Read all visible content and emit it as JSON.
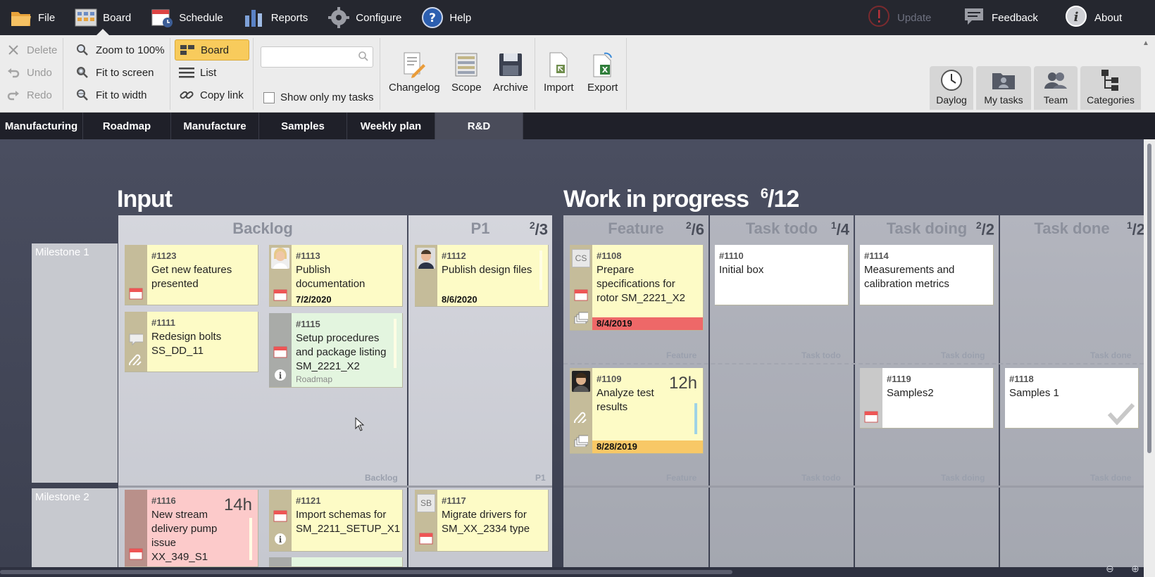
{
  "menu": {
    "file": "File",
    "board": "Board",
    "schedule": "Schedule",
    "reports": "Reports",
    "configure": "Configure",
    "help": "Help",
    "update": "Update",
    "feedback": "Feedback",
    "about": "About"
  },
  "ribbon": {
    "delete": "Delete",
    "undo": "Undo",
    "redo": "Redo",
    "zoom_100": "Zoom to 100%",
    "fit_screen": "Fit to screen",
    "fit_width": "Fit to width",
    "board_view": "Board",
    "list_view": "List",
    "copy_link": "Copy link",
    "search_value": "",
    "show_only_my_tasks": "Show only my tasks",
    "changelog": "Changelog",
    "scope": "Scope",
    "archive": "Archive",
    "import": "Import",
    "export": "Export",
    "daylog": "Daylog",
    "my_tasks": "My tasks",
    "team": "Team",
    "categories": "Categories"
  },
  "tabs": [
    "Manufacturing",
    "Roadmap",
    "Manufacture",
    "Samples",
    "Weekly plan",
    "R&D"
  ],
  "active_tab": "R&D",
  "sections": {
    "input": "Input",
    "wip": "Work in progress",
    "wip_count": "6",
    "wip_limit": "/12"
  },
  "columns": {
    "backlog": "Backlog",
    "p1": "P1",
    "p1_count": "2",
    "p1_limit": "/3",
    "feature": "Feature",
    "feature_count": "2",
    "feature_limit": "/6",
    "task_todo": "Task todo",
    "task_todo_count": "1",
    "task_todo_limit": "/4",
    "task_doing": "Task doing",
    "task_doing_count": "2",
    "task_doing_limit": "/2",
    "task_done": "Task done",
    "task_done_count": "1",
    "task_done_limit": "/2"
  },
  "milestones": [
    "Milestone 1",
    "Milestone 2"
  ],
  "cards": {
    "c1123": {
      "id": "#1123",
      "title": "Get new features presented"
    },
    "c1113": {
      "id": "#1113",
      "title": "Publish documentation",
      "date": "7/2/2020"
    },
    "c1111": {
      "id": "#1111",
      "title": "Redesign bolts SS_DD_11"
    },
    "c1115": {
      "id": "#1115",
      "title": "Setup procedures and package listing SM_2221_X2",
      "sub": "Roadmap"
    },
    "c1112": {
      "id": "#1112",
      "title": "Publish design files",
      "date": "8/6/2020"
    },
    "c1108": {
      "id": "#1108",
      "title": "Prepare specifications for rotor SM_2221_X2",
      "date": "8/4/2019",
      "initials": "CS"
    },
    "c1110": {
      "id": "#1110",
      "title": "Initial box"
    },
    "c1114": {
      "id": "#1114",
      "title": "Measurements and calibration metrics"
    },
    "c1109": {
      "id": "#1109",
      "title": "Analyze test results",
      "date": "8/28/2019",
      "hours": "12h"
    },
    "c1119": {
      "id": "#1119",
      "title": "Samples2"
    },
    "c1118": {
      "id": "#1118",
      "title": "Samples 1"
    },
    "c1116": {
      "id": "#1116",
      "title": "New stream delivery pump issue XX_349_S1",
      "hours": "14h"
    },
    "c1121": {
      "id": "#1121",
      "title": "Import schemas for SM_2211_SETUP_X1"
    },
    "c1117": {
      "id": "#1117",
      "title": "Migrate drivers for SM_XX_2334 type",
      "initials": "SB"
    }
  },
  "colors": {
    "card_yellow": "#fdfbc6",
    "card_green": "#e3f5df",
    "card_white": "#ffffff",
    "card_red": "#fccaca",
    "date_red": "#ee6868",
    "date_orange": "#f8c866"
  }
}
